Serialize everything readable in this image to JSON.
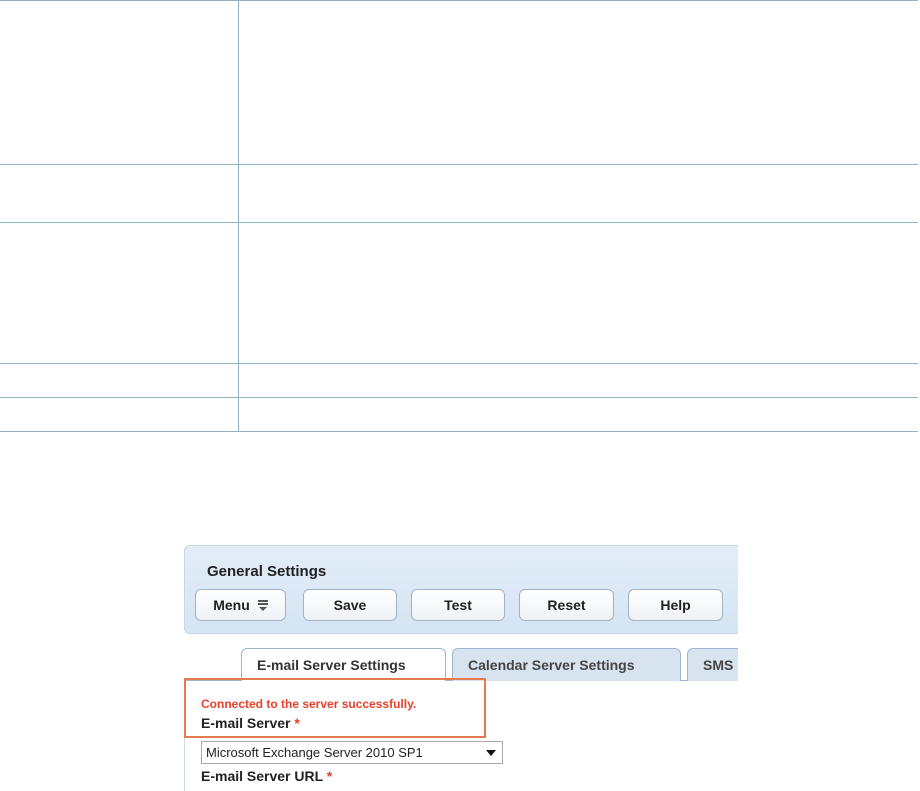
{
  "figure": {
    "panel_title": "General Settings",
    "toolbar": {
      "menu_label": "Menu",
      "save_label": "Save",
      "test_label": "Test",
      "reset_label": "Reset",
      "help_label": "Help"
    },
    "tabs": [
      {
        "label": "E-mail Server Settings",
        "active": true
      },
      {
        "label": "Calendar Server Settings",
        "active": false
      },
      {
        "label": "SMS",
        "active": false
      }
    ],
    "status_message": "Connected to the server successfully.",
    "email_server_label": "E-mail Server",
    "email_server_value": "Microsoft Exchange Server 2010 SP1",
    "email_server_url_label": "E-mail Server URL",
    "required_marker": "*"
  }
}
